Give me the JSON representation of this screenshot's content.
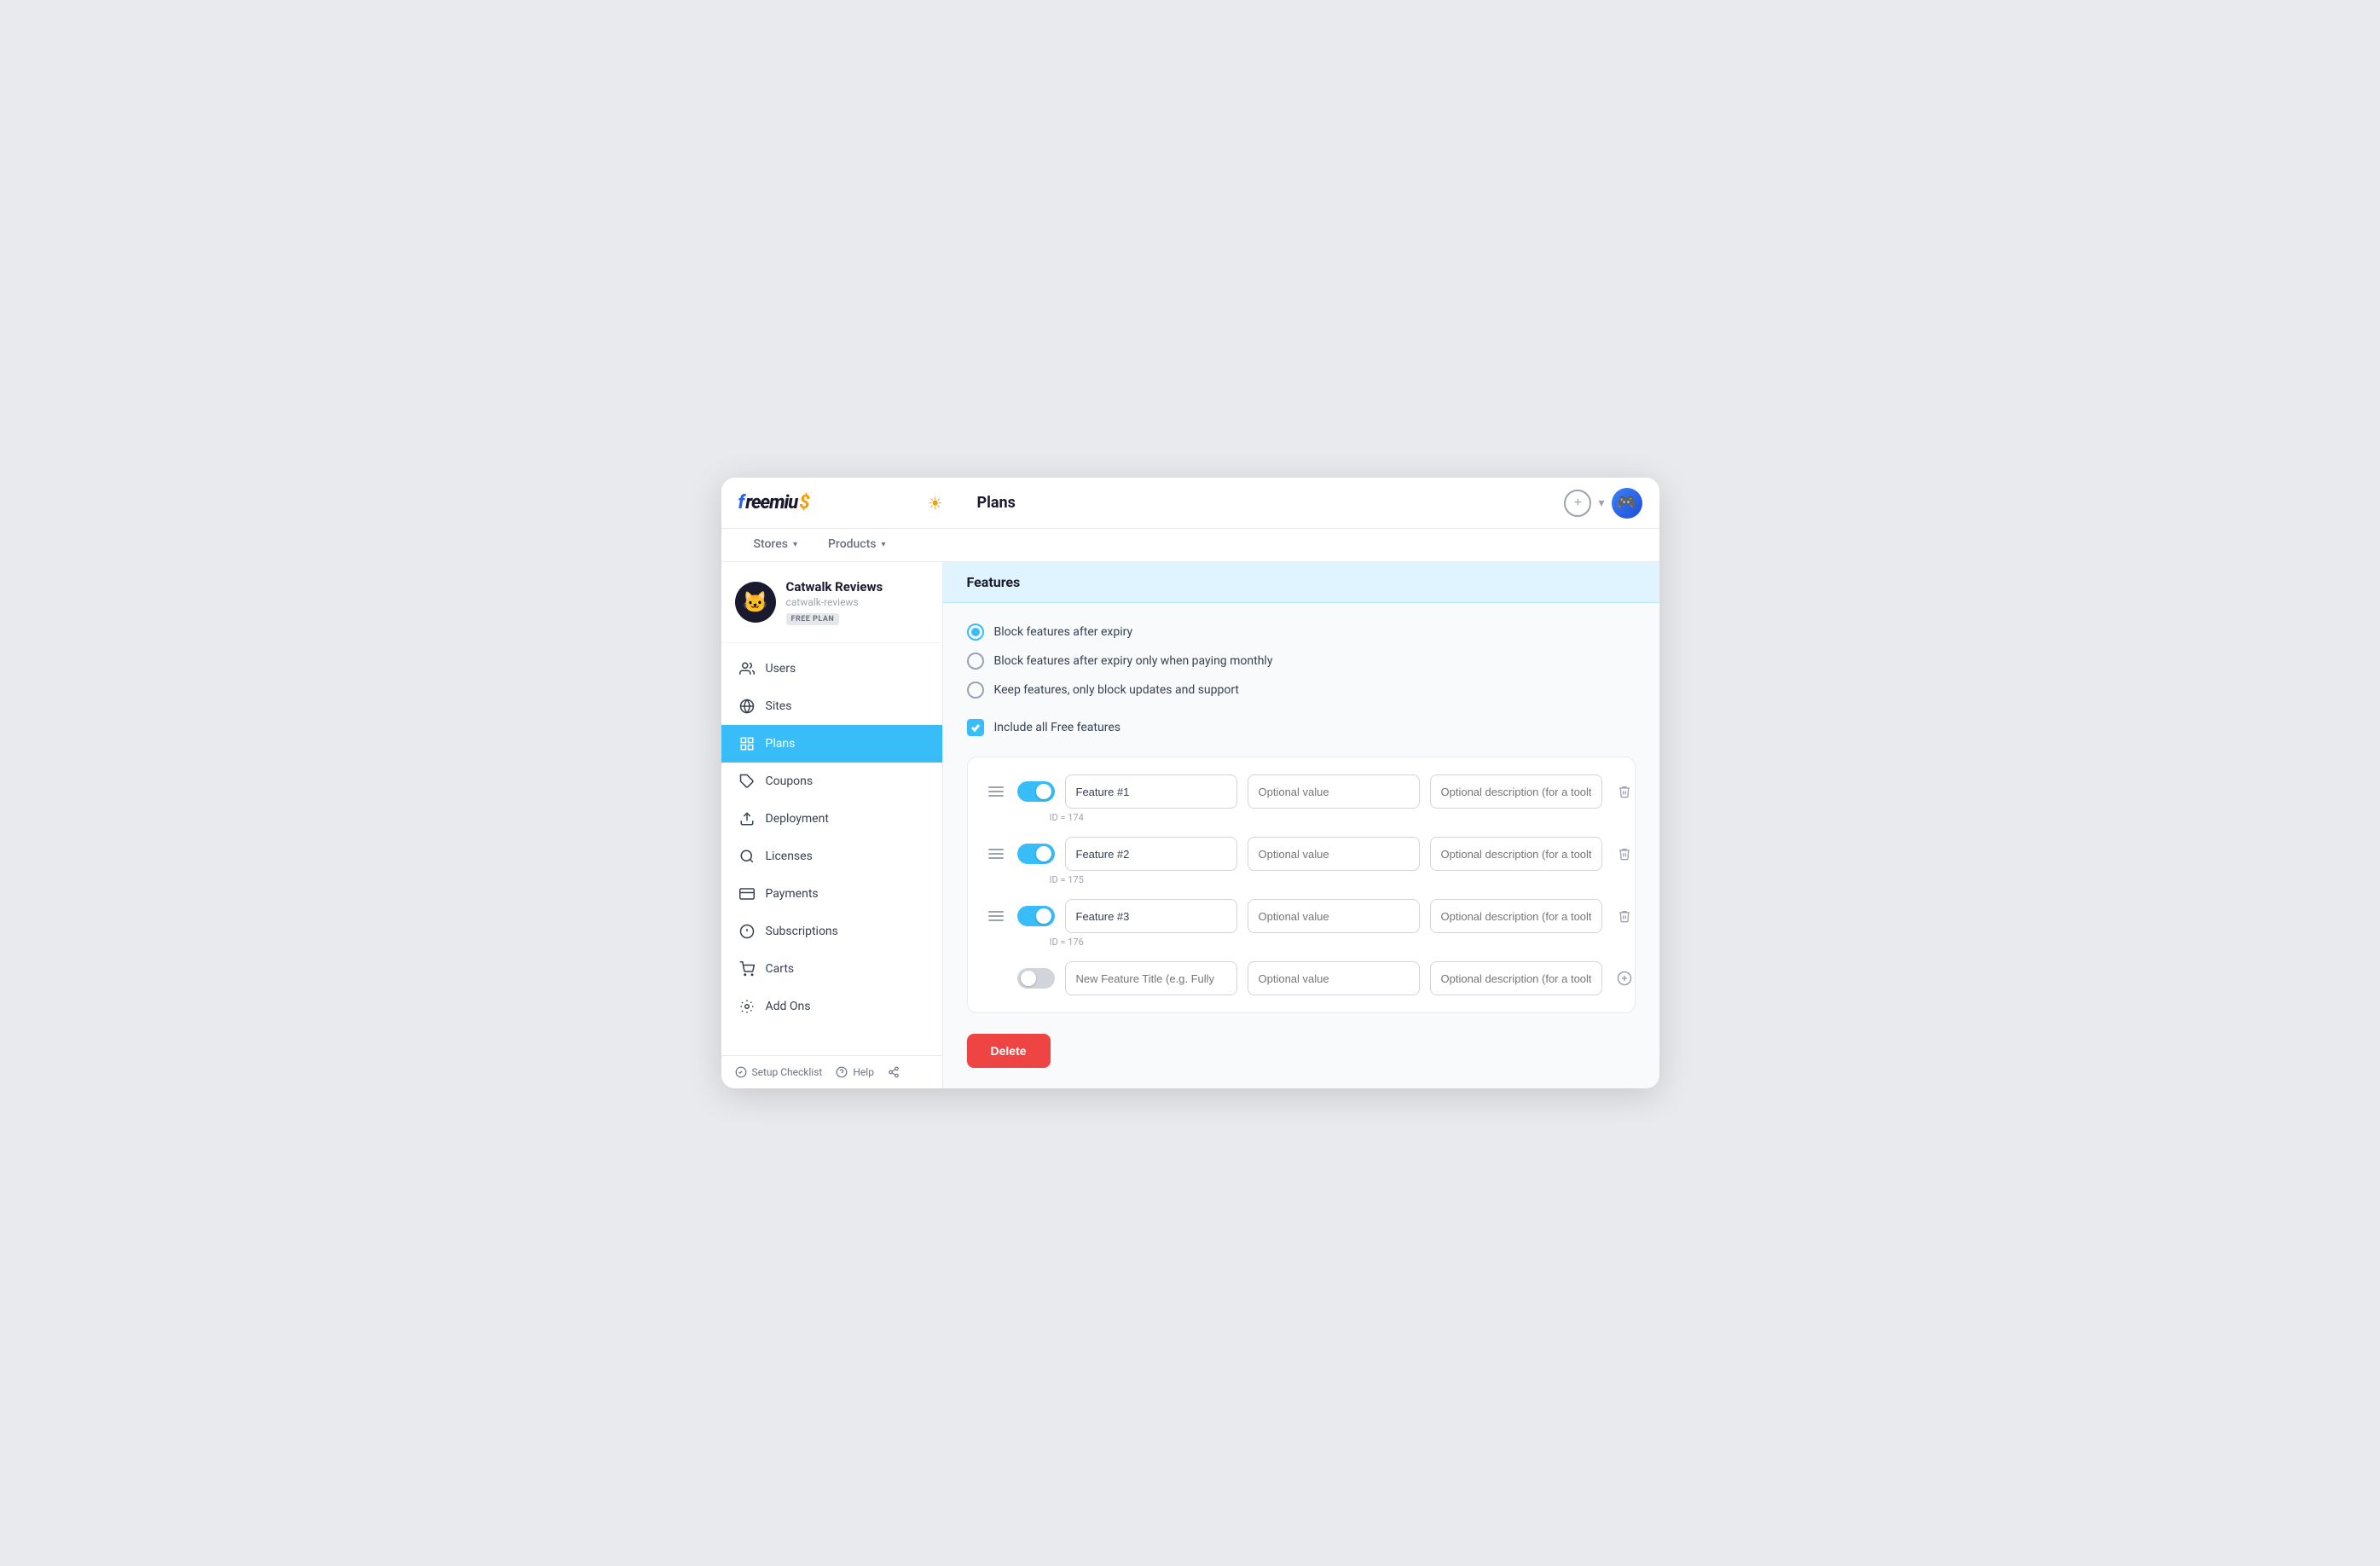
{
  "app": {
    "logo": "freemius",
    "logo_symbol": "$"
  },
  "header": {
    "page_title": "Plans",
    "sun_icon": "☀",
    "plus_icon": "+",
    "chevron_icon": "▾"
  },
  "nav_tabs": [
    {
      "label": "Stores",
      "has_caret": true
    },
    {
      "label": "Products",
      "has_caret": true
    }
  ],
  "sidebar": {
    "product": {
      "name": "Catwalk Reviews",
      "slug": "catwalk-reviews",
      "badge": "FREE PLAN",
      "emoji": "🐱"
    },
    "items": [
      {
        "label": "Users",
        "icon": "users"
      },
      {
        "label": "Sites",
        "icon": "globe"
      },
      {
        "label": "Plans",
        "icon": "grid",
        "active": true
      },
      {
        "label": "Coupons",
        "icon": "coupon"
      },
      {
        "label": "Deployment",
        "icon": "upload"
      },
      {
        "label": "Licenses",
        "icon": "search"
      },
      {
        "label": "Payments",
        "icon": "payments"
      },
      {
        "label": "Subscriptions",
        "icon": "subscriptions"
      },
      {
        "label": "Carts",
        "icon": "cart"
      },
      {
        "label": "Add Ons",
        "icon": "addons"
      }
    ],
    "footer": [
      {
        "label": "Setup Checklist",
        "icon": "checklist"
      },
      {
        "label": "Help",
        "icon": "help"
      },
      {
        "label": "Share",
        "icon": "share"
      }
    ]
  },
  "content": {
    "section_title": "Features",
    "radio_options": [
      {
        "label": "Block features after expiry",
        "checked": true
      },
      {
        "label": "Block features after expiry only when paying monthly",
        "checked": false
      },
      {
        "label": "Keep features, only block updates and support",
        "checked": false
      }
    ],
    "checkbox": {
      "label": "Include all Free features",
      "checked": true
    },
    "features": [
      {
        "id": "ID = 174",
        "title": "Feature #1",
        "value_placeholder": "Optional value",
        "desc_placeholder": "Optional description (for a tooltip)",
        "enabled": true
      },
      {
        "id": "ID = 175",
        "title": "Feature #2",
        "value_placeholder": "Optional value",
        "desc_placeholder": "Optional description (for a tooltip)",
        "enabled": true
      },
      {
        "id": "ID = 176",
        "title": "Feature #3",
        "value_placeholder": "Optional value",
        "desc_placeholder": "Optional description (for a tooltip)",
        "enabled": true
      },
      {
        "id": "",
        "title": "",
        "title_placeholder": "New Feature Title (e.g. Fully",
        "value_placeholder": "Optional value",
        "desc_placeholder": "Optional description (for a tooltip)",
        "enabled": false,
        "is_new": true
      }
    ],
    "delete_button": "Delete"
  }
}
